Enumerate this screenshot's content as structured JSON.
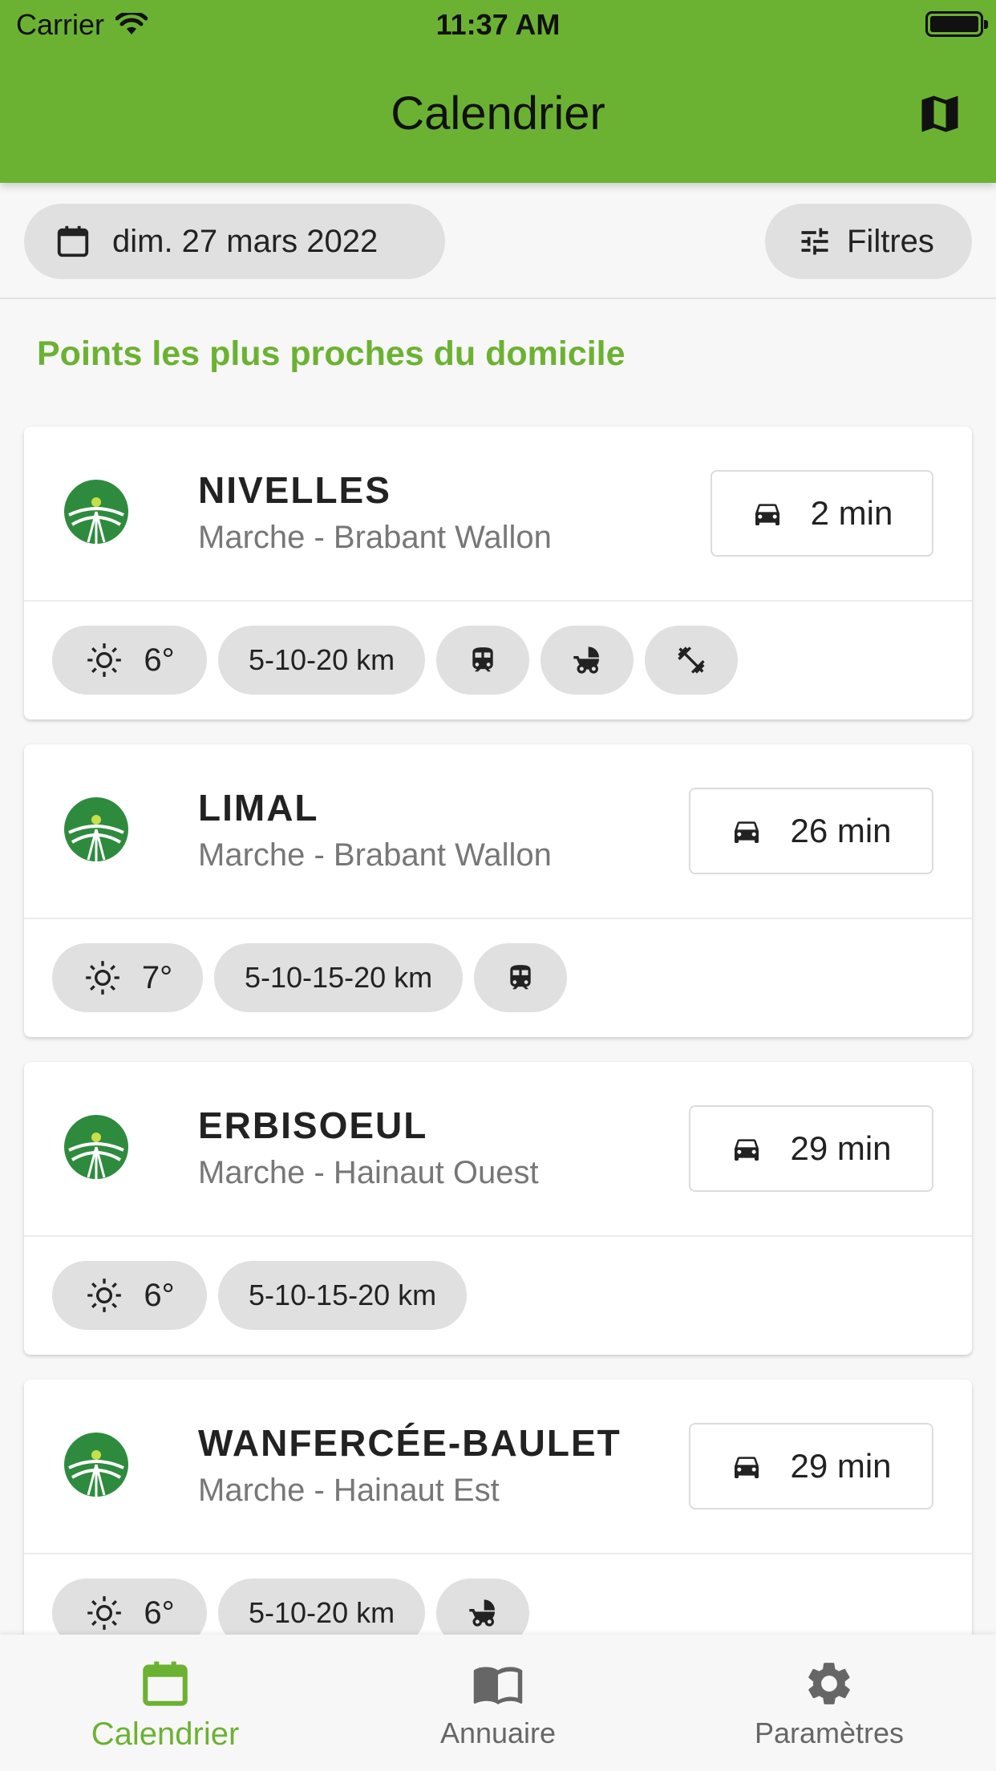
{
  "status_bar": {
    "carrier": "Carrier",
    "time": "11:37 AM"
  },
  "header": {
    "title": "Calendrier"
  },
  "toolbar": {
    "date": "dim. 27 mars 2022",
    "filters": "Filtres"
  },
  "section": {
    "title": "Points les plus proches du domicile"
  },
  "cards": [
    {
      "name": "NIVELLES",
      "subtitle": "Marche - Brabant Wallon",
      "drive": "2 min",
      "temp": "6°",
      "distances": "5-10-20 km",
      "icons": [
        "train-icon",
        "stroller-icon",
        "fitness-icon"
      ]
    },
    {
      "name": "LIMAL",
      "subtitle": "Marche - Brabant Wallon",
      "drive": "26 min",
      "temp": "7°",
      "distances": "5-10-15-20 km",
      "icons": [
        "train-icon"
      ]
    },
    {
      "name": "ERBISOEUL",
      "subtitle": "Marche - Hainaut Ouest",
      "drive": "29 min",
      "temp": "6°",
      "distances": "5-10-15-20 km",
      "icons": []
    },
    {
      "name": "WANFERCÉE-BAULET",
      "subtitle": "Marche - Hainaut Est",
      "drive": "29 min",
      "temp": "6°",
      "distances": "5-10-20 km",
      "icons": [
        "stroller-icon"
      ]
    }
  ],
  "nav": {
    "calendar": "Calendrier",
    "directory": "Annuaire",
    "settings": "Paramètres"
  },
  "colors": {
    "accent": "#6cb232",
    "chip": "#e0e0e0"
  }
}
